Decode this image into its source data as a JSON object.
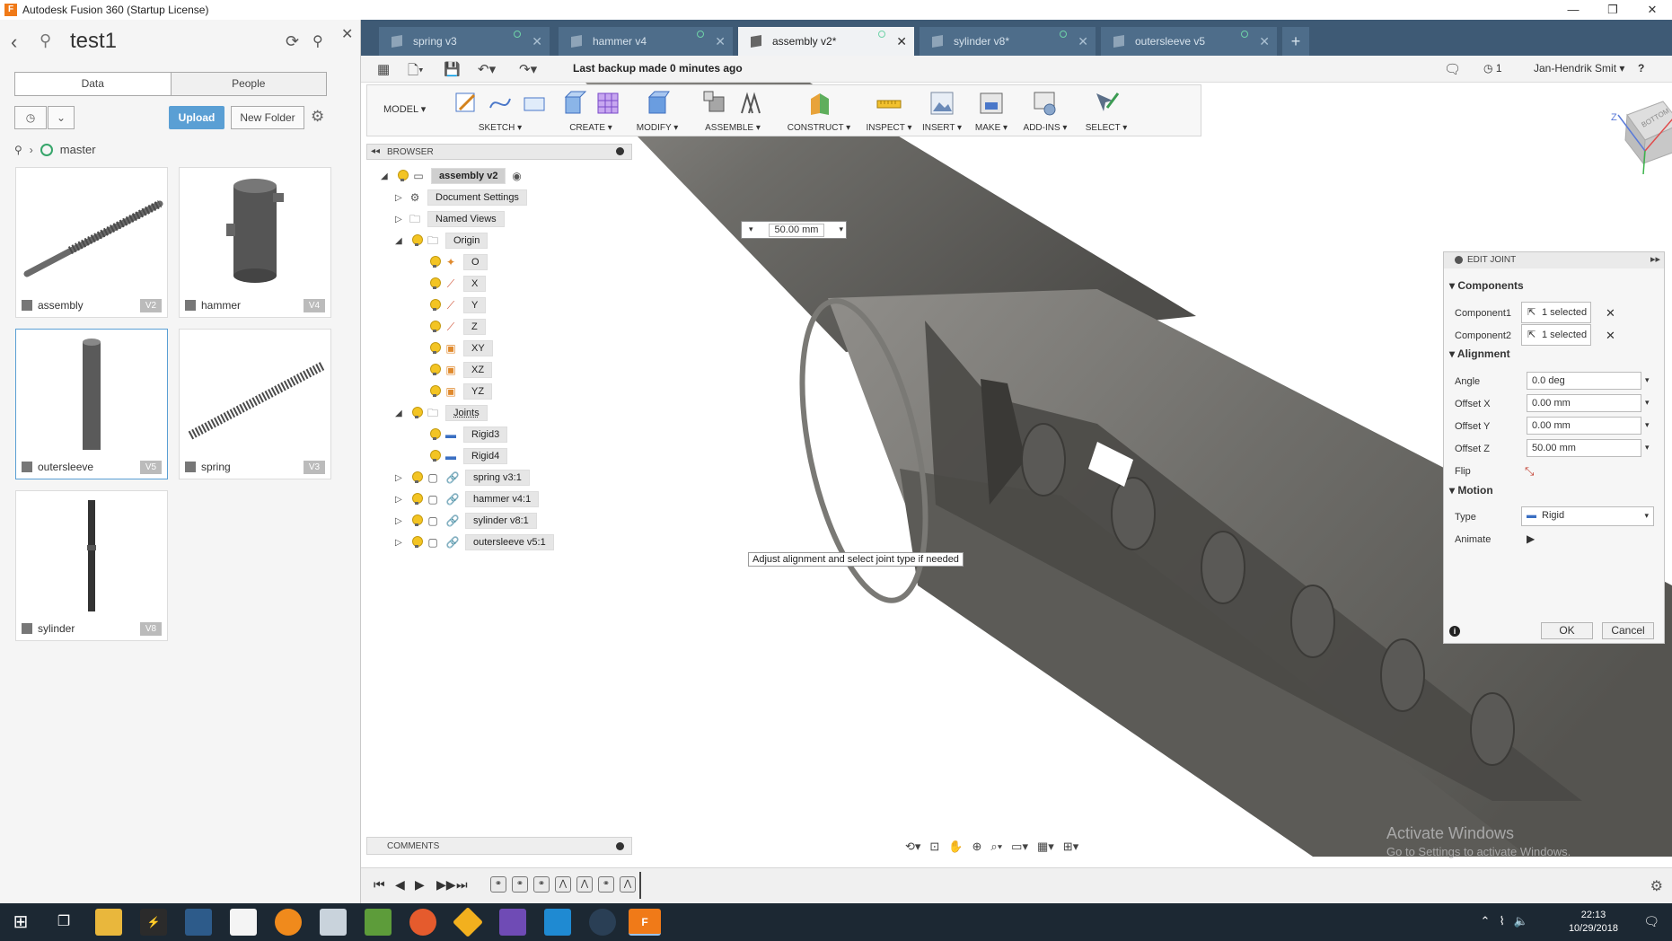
{
  "window": {
    "app_icon": "F",
    "title": "Autodesk Fusion 360 (Startup License)",
    "minimize": "—",
    "maximize": "❐",
    "close": "✕"
  },
  "data_panel": {
    "project_title": "test1",
    "tabs": [
      "Data",
      "People"
    ],
    "upload_label": "Upload",
    "new_folder_label": "New Folder",
    "breadcrumb_current": "master",
    "items": [
      {
        "name": "assembly",
        "version": "V2"
      },
      {
        "name": "hammer",
        "version": "V4"
      },
      {
        "name": "outersleeve",
        "version": "V5"
      },
      {
        "name": "spring",
        "version": "V3"
      },
      {
        "name": "sylinder",
        "version": "V8"
      }
    ]
  },
  "doc_tabs": [
    {
      "label": "spring v3"
    },
    {
      "label": "hammer v4"
    },
    {
      "label": "assembly v2*"
    },
    {
      "label": "sylinder v8*"
    },
    {
      "label": "outersleeve v5"
    }
  ],
  "quick_access": {
    "backup_text": "Last backup made 0 minutes ago",
    "history_count": "1",
    "user_name": "Jan-Hendrik Smit ▾",
    "help": "?"
  },
  "ribbon": {
    "workspace": "MODEL ▾",
    "groups": [
      "SKETCH ▾",
      "CREATE ▾",
      "MODIFY ▾",
      "ASSEMBLE ▾",
      "CONSTRUCT ▾",
      "INSPECT ▾",
      "INSERT ▾",
      "MAKE ▾",
      "ADD-INS ▾",
      "SELECT ▾"
    ]
  },
  "browser": {
    "title": "BROWSER",
    "root": "assembly v2",
    "nodes": {
      "document_settings": "Document Settings",
      "named_views": "Named Views",
      "origin": "Origin",
      "origin_items": [
        "O",
        "X",
        "Y",
        "Z",
        "XY",
        "XZ",
        "YZ"
      ],
      "joints": "Joints",
      "joint_items": [
        "Rigid3",
        "Rigid4"
      ],
      "components": [
        "spring v3:1",
        "hammer v4:1",
        "sylinder v8:1",
        "outersleeve v5:1"
      ]
    }
  },
  "dimension_input": {
    "value": "50.00 mm"
  },
  "tooltip": "Adjust alignment and select joint type if needed",
  "edit_joint": {
    "title": "EDIT JOINT",
    "components_header": "Components",
    "component1_label": "Component1",
    "component1_value": "1 selected",
    "component2_label": "Component2",
    "component2_value": "1 selected",
    "alignment_header": "Alignment",
    "angle_label": "Angle",
    "angle_value": "0.0 deg",
    "offset_x_label": "Offset X",
    "offset_x_value": "0.00 mm",
    "offset_y_label": "Offset Y",
    "offset_y_value": "0.00 mm",
    "offset_z_label": "Offset Z",
    "offset_z_value": "50.00 mm",
    "flip_label": "Flip",
    "motion_header": "Motion",
    "type_label": "Type",
    "type_value": "Rigid",
    "animate_label": "Animate",
    "ok_label": "OK",
    "cancel_label": "Cancel"
  },
  "comments_title": "COMMENTS",
  "viewcube_label": "BOTTOM",
  "watermark": {
    "line1": "Activate Windows",
    "line2": "Go to Settings to activate Windows."
  },
  "taskbar": {
    "time": "22:13",
    "date": "10/29/2018"
  },
  "colors": {
    "accent": "#5a9fd4",
    "tabbar": "#3e5a75",
    "taskbar": "#1c2833",
    "model": "#6e6d69"
  }
}
